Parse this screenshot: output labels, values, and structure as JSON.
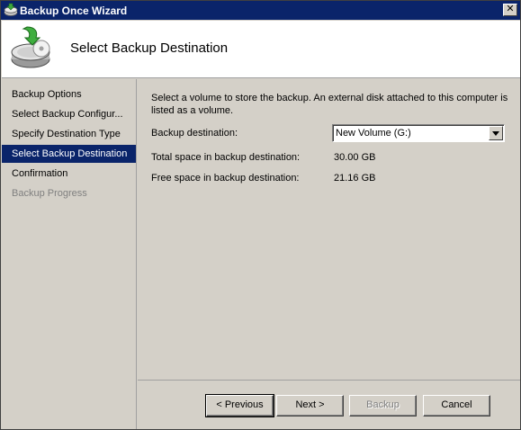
{
  "window": {
    "title": "Backup Once Wizard",
    "close_label": "✕"
  },
  "header": {
    "title": "Select Backup Destination",
    "icon": "backup-disk-icon"
  },
  "nav": {
    "items": [
      {
        "label": "Backup Options",
        "state": "normal"
      },
      {
        "label": "Select Backup Configur...",
        "state": "normal"
      },
      {
        "label": "Specify Destination Type",
        "state": "normal"
      },
      {
        "label": "Select Backup Destination",
        "state": "selected"
      },
      {
        "label": "Confirmation",
        "state": "normal"
      },
      {
        "label": "Backup Progress",
        "state": "disabled"
      }
    ]
  },
  "content": {
    "description": "Select a volume to store the backup. An external disk attached to this computer is listed as a volume.",
    "destination_label": "Backup destination:",
    "destination_value": "New Volume (G:)",
    "total_label": "Total space in backup destination:",
    "total_value": "30.00 GB",
    "free_label": "Free space in backup destination:",
    "free_value": "21.16 GB"
  },
  "buttons": {
    "previous": "< Previous",
    "next": "Next >",
    "backup": "Backup",
    "cancel": "Cancel"
  },
  "colors": {
    "titlebar": "#0a246a",
    "selected_nav": "#0a246a",
    "face": "#d4d0c8"
  }
}
